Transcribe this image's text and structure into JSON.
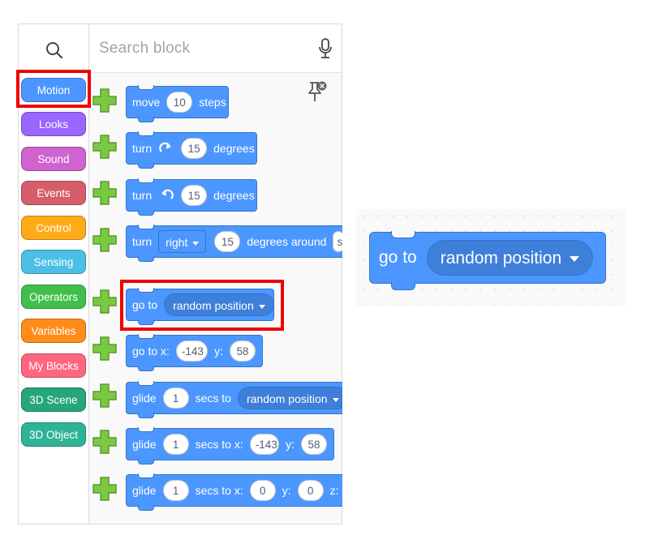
{
  "search": {
    "placeholder": "Search block"
  },
  "categories": [
    {
      "label": "Motion",
      "color": "#4c97ff"
    },
    {
      "label": "Looks",
      "color": "#9966ff"
    },
    {
      "label": "Sound",
      "color": "#cf63cf"
    },
    {
      "label": "Events",
      "color": "#d65e6b"
    },
    {
      "label": "Control",
      "color": "#ffab19"
    },
    {
      "label": "Sensing",
      "color": "#4cbfe6"
    },
    {
      "label": "Operators",
      "color": "#40bf4a"
    },
    {
      "label": "Variables",
      "color": "#ff8c1a"
    },
    {
      "label": "My Blocks",
      "color": "#ff6680"
    },
    {
      "label": "3D Scene",
      "color": "#26a67a"
    },
    {
      "label": "3D Object",
      "color": "#2fb396"
    }
  ],
  "blocks": {
    "move": {
      "t1": "move",
      "steps": "10",
      "t2": "steps"
    },
    "turn_right": {
      "t1": "turn",
      "deg": "15",
      "t2": "degrees"
    },
    "turn_left": {
      "t1": "turn",
      "deg": "15",
      "t2": "degrees"
    },
    "turn_around": {
      "t1": "turn",
      "dir": "right",
      "deg": "15",
      "t2": "degrees around",
      "t3": "s"
    },
    "goto": {
      "t1": "go to",
      "target": "random position"
    },
    "goto_xy": {
      "t1": "go to x:",
      "x": "-143",
      "t2": "y:",
      "y": "58"
    },
    "glide_to": {
      "t1": "glide",
      "secs": "1",
      "t2": "secs to",
      "target": "random position"
    },
    "glide_xy": {
      "t1": "glide",
      "secs": "1",
      "t2": "secs to x:",
      "x": "-143",
      "t3": "y:",
      "y": "58"
    },
    "glide_xyz": {
      "t1": "glide",
      "secs": "1",
      "t2": "secs to x:",
      "x": "0",
      "t3": "y:",
      "y": "0",
      "t4": "z:"
    }
  },
  "zoom": {
    "t1": "go to",
    "target": "random position"
  },
  "colors": {
    "motion": "#4c97ff",
    "highlight": "#ee0000",
    "add": "#7ac943"
  }
}
